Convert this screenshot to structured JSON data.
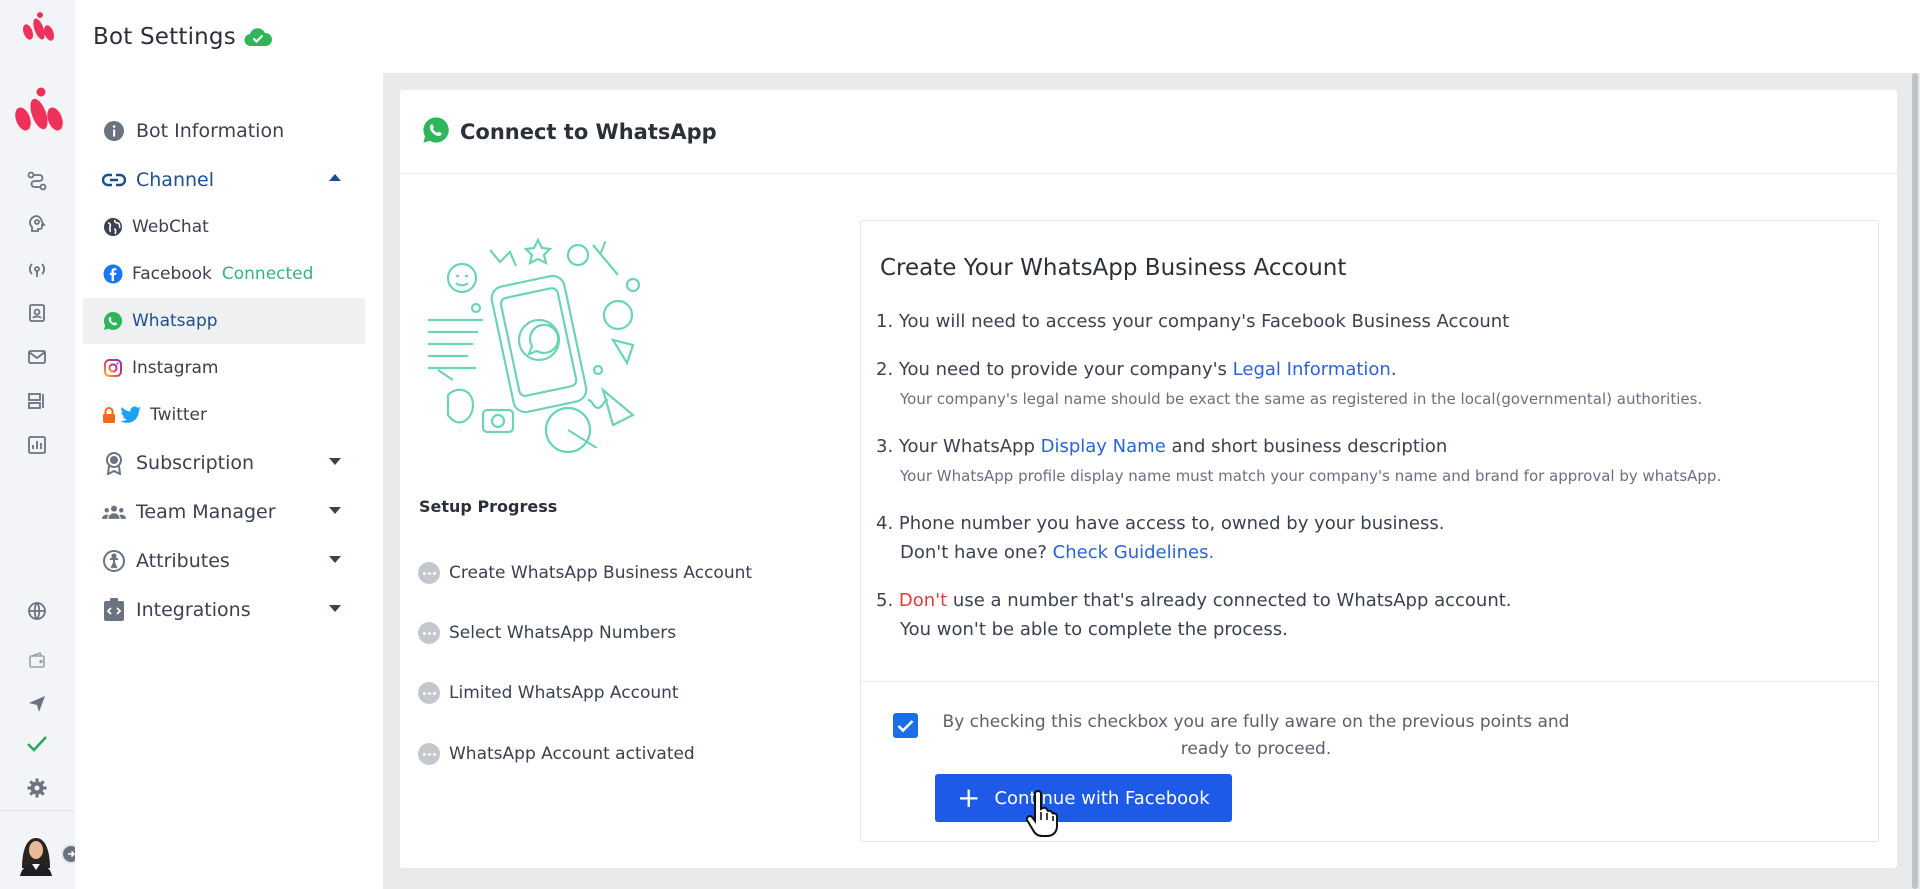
{
  "header": {
    "title": "Bot Settings",
    "cloud_icon": "cloud-check-icon"
  },
  "sidebar": {
    "items": [
      {
        "label": "Bot Information",
        "icon": "info-icon"
      },
      {
        "label": "Channel",
        "icon": "link-icon",
        "expanded": true
      },
      {
        "label": "Subscription",
        "icon": "badge-icon"
      },
      {
        "label": "Team Manager",
        "icon": "team-icon"
      },
      {
        "label": "Attributes",
        "icon": "person-circle-icon"
      },
      {
        "label": "Integrations",
        "icon": "code-box-icon"
      }
    ],
    "channels": [
      {
        "label": "WebChat",
        "icon": "globe-icon"
      },
      {
        "label": "Facebook",
        "icon": "facebook-icon",
        "status": "Connected"
      },
      {
        "label": "Whatsapp",
        "icon": "whatsapp-icon",
        "active": true
      },
      {
        "label": "Instagram",
        "icon": "instagram-icon"
      },
      {
        "label": "Twitter",
        "icon": "twitter-icon",
        "locked": true
      }
    ]
  },
  "card": {
    "title": "Connect to WhatsApp",
    "progress_title": "Setup Progress",
    "steps": [
      "Create WhatsApp Business Account",
      "Select WhatsApp Numbers",
      "Limited WhatsApp Account",
      "WhatsApp Account activated"
    ],
    "info": {
      "title": "Create Your WhatsApp Business Account",
      "p1": "1. You will need to access your company's Facebook Business Account",
      "p2_prefix": "2. You need to provide your company's ",
      "p2_link": "Legal Information",
      "p2_suffix": ".",
      "p2_note": "Your company's legal name should be exact the same as registered in the local(governmental) authorities.",
      "p3_prefix": "3. Your WhatsApp ",
      "p3_link": "Display Name",
      "p3_suffix": " and short business description",
      "p3_note": "Your WhatsApp profile display name must match your company's name and brand for approval by whatsApp.",
      "p4_line1": "4. Phone number you have access to, owned by your business.",
      "p4_prefix": "Don't have one? ",
      "p4_link": "Check Guidelines.",
      "p5_prefix": "5. ",
      "p5_red": "Don't",
      "p5_suffix": " use a number that's already connected to WhatsApp account.",
      "p5_line2": "You won't be able to complete the process."
    },
    "consent_text": "By checking this checkbox you are fully aware on the previous points and ready to proceed.",
    "consent_checked": true,
    "button_label": "Continue with Facebook"
  },
  "colors": {
    "accent": "#1e5ae8",
    "brand": "#f0325a",
    "whatsapp": "#2fb65a",
    "connected": "#38b27a"
  }
}
